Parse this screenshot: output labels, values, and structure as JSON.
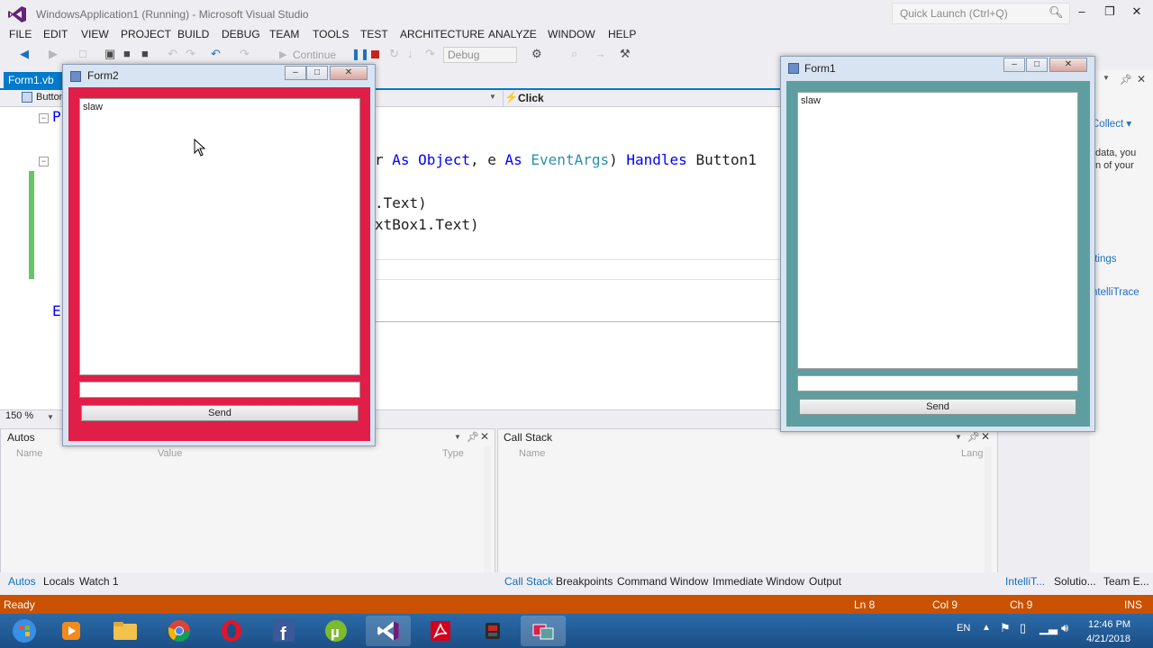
{
  "vs": {
    "title": "WindowsApplication1 (Running) - Microsoft Visual Studio",
    "quick_launch_placeholder": "Quick Launch (Ctrl+Q)",
    "menu": [
      "FILE",
      "EDIT",
      "VIEW",
      "PROJECT",
      "BUILD",
      "DEBUG",
      "TEAM",
      "TOOLS",
      "TEST",
      "ARCHITECTURE",
      "ANALYZE",
      "WINDOW",
      "HELP"
    ],
    "toolbar": {
      "continue_label": "Continue",
      "config": "Debug"
    },
    "doc_tab": "Form1.vb",
    "nav_left": "Button",
    "nav_right": "Click",
    "code": {
      "line1_a": "r ",
      "line1_kw1": "As",
      "line1_b": " ",
      "line1_kw2": "Object",
      "line1_c": ", e ",
      "line1_kw3": "As",
      "line1_d": " ",
      "line1_ty": "EventArgs",
      "line1_e": ") ",
      "line1_kw4": "Handles",
      "line1_f": " Button1",
      "line2": ".Text)",
      "line3": "xtBox1.Text)",
      "left_p": "P",
      "left_e": "E"
    },
    "zoom": "150 %",
    "right_panel": {
      "collect": "Collect",
      "text1": "data, you",
      "text2": "n of your",
      "settings": "ttings",
      "intellitrace": "ntelliTrace"
    },
    "autos": {
      "title": "Autos",
      "col_name": "Name",
      "col_value": "Value",
      "col_type": "Type"
    },
    "callstack": {
      "title": "Call Stack",
      "col_name": "Name",
      "col_lang": "Lang"
    },
    "bottom_tabs_left": [
      "Autos",
      "Locals",
      "Watch 1"
    ],
    "bottom_tabs_mid": [
      "Call Stack",
      "Breakpoints",
      "Command Window",
      "Immediate Window",
      "Output"
    ],
    "bottom_tabs_right": [
      "IntelliT...",
      "Solutio...",
      "Team E..."
    ],
    "status": {
      "ready": "Ready",
      "ln": "Ln 8",
      "col": "Col 9",
      "ch": "Ch 9",
      "mode": "INS"
    }
  },
  "form2": {
    "title": "Form2",
    "text": "slaw",
    "send": "Send",
    "color": "#e01e48"
  },
  "form1": {
    "title": "Form1",
    "text": "slaw",
    "send": "Send",
    "color": "#5f9ea0"
  },
  "taskbar": {
    "icons": [
      "windows-start-icon",
      "media-player-icon",
      "file-explorer-icon",
      "chrome-icon",
      "opera-icon",
      "facebook-icon",
      "utorrent-icon",
      "visual-studio-icon",
      "acrobat-icon",
      "app-icon",
      "windows-forms-app-icon"
    ],
    "lang": "EN",
    "time": "12:46 PM",
    "date": "4/21/2018"
  }
}
